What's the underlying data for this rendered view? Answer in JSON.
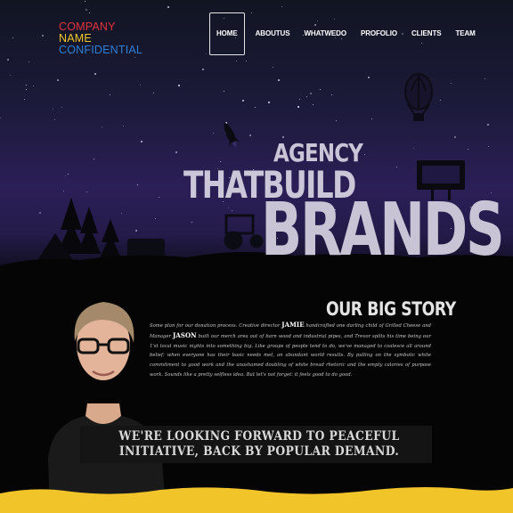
{
  "logo": {
    "line1": "COMPANY",
    "line2": "NAME",
    "line3": "CONFIDENTIAL"
  },
  "nav": {
    "items": [
      {
        "label": "HOME",
        "active": true
      },
      {
        "label": "ABOUTUS"
      },
      {
        "label": "WHATWEDO"
      },
      {
        "label": "PROFOLIO"
      },
      {
        "label": "CLIENTS"
      },
      {
        "label": "TEAM"
      }
    ]
  },
  "hero": {
    "line1": "AGENCY",
    "line2": "THATBUILD",
    "line3": "BRANDS"
  },
  "story": {
    "title": "OUR BIG STORY",
    "body_before_jamie": "Some plan for our donation process. Creative director ",
    "jamie": "JAMIE",
    "body_middle": " handcrafted one darling child of Grilled Cheese and Manager ",
    "jason": "JASON",
    "body_after_jason": " built our merch area out of barn wood and industrial pipes, and Trevor splits his time being our 1'st local music nights into something big. Like groups of people tend to do, we've managed to coalesce all around belief: when everyone has their basic needs met, an abundant world results. By pulling on the symbolic white commitment to good work and the unashamed doubling of white bread rhetoric and the empty calories of purpose work. Sounds like a pretty selfless idea.  But let's not forget: it feels good to do good."
  },
  "quote": {
    "line1": "WE'RE LOOKING FORWARD TO PEACEFUL",
    "line2": "INITIATIVE, BACK BY POPULAR DEMAND."
  },
  "colors": {
    "logo_red": "#e2323c",
    "logo_yellow": "#f2c72a",
    "logo_blue": "#2e7fd6",
    "sky_purple": "#2b1f57",
    "wave_yellow": "#f1c42a"
  }
}
